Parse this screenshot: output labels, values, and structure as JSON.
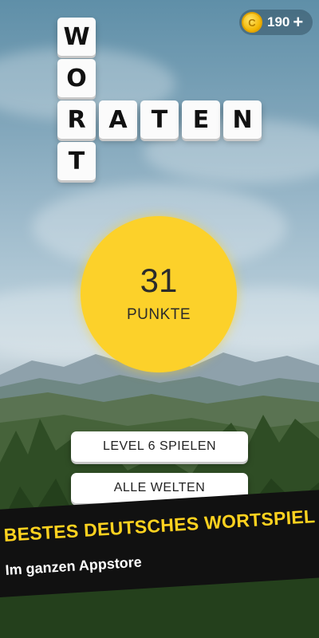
{
  "logo": {
    "vertical": [
      "W",
      "O",
      "R",
      "T"
    ],
    "horizontal": [
      "A",
      "T",
      "E",
      "N"
    ]
  },
  "currency": {
    "amount": "190",
    "coin_symbol": "C",
    "icon": "coin-icon",
    "add_icon": "plus-icon",
    "add_symbol": "+"
  },
  "score": {
    "value": "31",
    "label": "PUNKTE"
  },
  "buttons": {
    "play_label": "LEVEL 6 SPIELEN",
    "worlds_label": "ALLE WELTEN"
  },
  "promo": {
    "title": "BESTES DEUTSCHES WORTSPIEL",
    "subtitle": "Im ganzen Appstore"
  },
  "colors": {
    "accent": "#fcd12a",
    "promo_title": "#ffd21f",
    "banner": "#111111"
  }
}
